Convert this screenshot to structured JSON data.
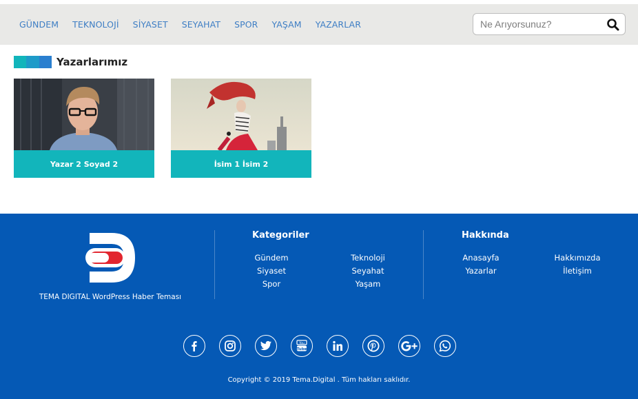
{
  "nav": {
    "items": [
      "GÜNDEM",
      "TEKNOLOJİ",
      "SİYASET",
      "SEYAHAT",
      "SPOR",
      "YAŞAM",
      "YAZARLAR"
    ],
    "color": "#3e7ec4"
  },
  "search": {
    "placeholder": "Ne Arıyorsunuz?",
    "icon": "search-icon"
  },
  "section": {
    "title": "Yazarlarımız",
    "bar_colors": [
      "#12b5bb",
      "#1e9bc9",
      "#2a7fcf"
    ]
  },
  "authors": [
    {
      "name": "Yazar 2 Soyad 2",
      "image": "man-with-glasses-photo"
    },
    {
      "name": "İsim 1 İsim 2",
      "image": "woman-with-red-scarf-photo"
    }
  ],
  "footer": {
    "background": "#0559b5",
    "logo_text": "TEMA DIGITAL WordPress Haber Teması",
    "categories": {
      "title": "Kategoriler",
      "links": [
        "Gündem",
        "Teknoloji",
        "Siyaset",
        "Seyahat",
        "Spor",
        "Yaşam"
      ]
    },
    "about": {
      "title": "Hakkında",
      "links": [
        "Anasayfa",
        "Hakkımızda",
        "Yazarlar",
        "İletişim"
      ]
    },
    "socials": [
      "facebook-icon",
      "instagram-icon",
      "twitter-icon",
      "youtube-icon",
      "linkedin-icon",
      "pinterest-icon",
      "google-plus-icon",
      "whatsapp-icon"
    ],
    "copyright": "Copyright © 2019 Tema.Digital . Tüm hakları saklıdır."
  },
  "colors": {
    "accent": "#12b5bb",
    "topbar": "#e9e9e7"
  }
}
